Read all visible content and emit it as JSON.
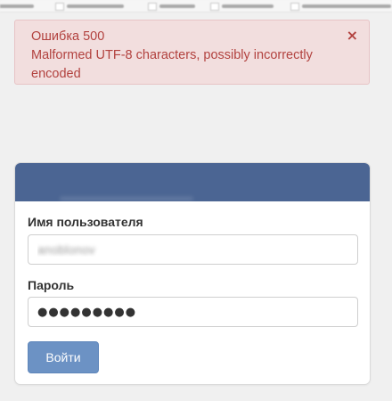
{
  "error": {
    "title": "Ошибка 500",
    "message": "Malformed UTF-8 characters, possibly incorrectly encoded",
    "close_glyph": "×",
    "color": "#b2423f",
    "background": "#f2dede"
  },
  "login": {
    "header_color": "#4b6593",
    "username_label": "Имя пользователя",
    "username_value": "anoblonov",
    "password_label": "Пароль",
    "password_value": "●●●●●●●●●",
    "submit_label": "Войти",
    "button_color": "#6c92c4"
  }
}
